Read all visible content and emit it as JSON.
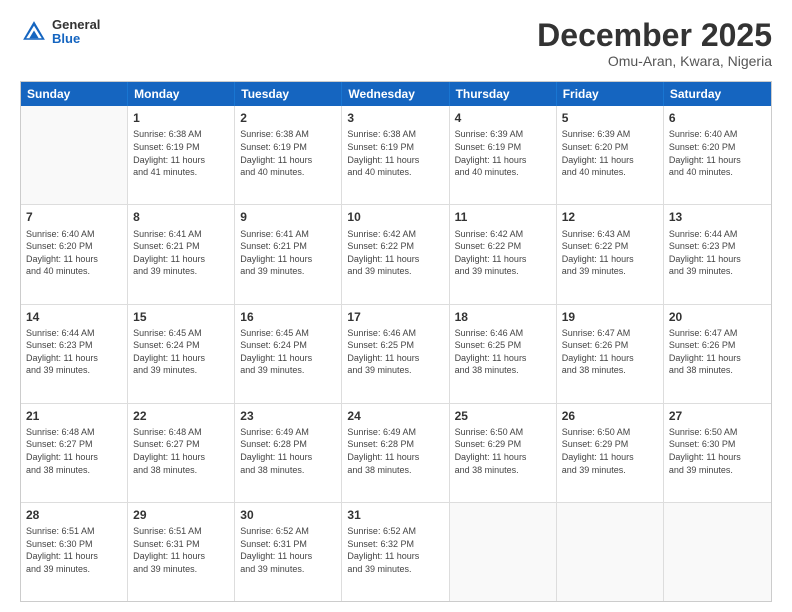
{
  "header": {
    "logo": {
      "general": "General",
      "blue": "Blue"
    },
    "title": "December 2025",
    "location": "Omu-Aran, Kwara, Nigeria"
  },
  "days": [
    "Sunday",
    "Monday",
    "Tuesday",
    "Wednesday",
    "Thursday",
    "Friday",
    "Saturday"
  ],
  "weeks": [
    [
      {
        "day": "",
        "sunrise": "",
        "sunset": "",
        "daylight": ""
      },
      {
        "day": "1",
        "sunrise": "Sunrise: 6:38 AM",
        "sunset": "Sunset: 6:19 PM",
        "daylight": "Daylight: 11 hours and 41 minutes."
      },
      {
        "day": "2",
        "sunrise": "Sunrise: 6:38 AM",
        "sunset": "Sunset: 6:19 PM",
        "daylight": "Daylight: 11 hours and 40 minutes."
      },
      {
        "day": "3",
        "sunrise": "Sunrise: 6:38 AM",
        "sunset": "Sunset: 6:19 PM",
        "daylight": "Daylight: 11 hours and 40 minutes."
      },
      {
        "day": "4",
        "sunrise": "Sunrise: 6:39 AM",
        "sunset": "Sunset: 6:19 PM",
        "daylight": "Daylight: 11 hours and 40 minutes."
      },
      {
        "day": "5",
        "sunrise": "Sunrise: 6:39 AM",
        "sunset": "Sunset: 6:20 PM",
        "daylight": "Daylight: 11 hours and 40 minutes."
      },
      {
        "day": "6",
        "sunrise": "Sunrise: 6:40 AM",
        "sunset": "Sunset: 6:20 PM",
        "daylight": "Daylight: 11 hours and 40 minutes."
      }
    ],
    [
      {
        "day": "7",
        "sunrise": "Sunrise: 6:40 AM",
        "sunset": "Sunset: 6:20 PM",
        "daylight": "Daylight: 11 hours and 40 minutes."
      },
      {
        "day": "8",
        "sunrise": "Sunrise: 6:41 AM",
        "sunset": "Sunset: 6:21 PM",
        "daylight": "Daylight: 11 hours and 39 minutes."
      },
      {
        "day": "9",
        "sunrise": "Sunrise: 6:41 AM",
        "sunset": "Sunset: 6:21 PM",
        "daylight": "Daylight: 11 hours and 39 minutes."
      },
      {
        "day": "10",
        "sunrise": "Sunrise: 6:42 AM",
        "sunset": "Sunset: 6:22 PM",
        "daylight": "Daylight: 11 hours and 39 minutes."
      },
      {
        "day": "11",
        "sunrise": "Sunrise: 6:42 AM",
        "sunset": "Sunset: 6:22 PM",
        "daylight": "Daylight: 11 hours and 39 minutes."
      },
      {
        "day": "12",
        "sunrise": "Sunrise: 6:43 AM",
        "sunset": "Sunset: 6:22 PM",
        "daylight": "Daylight: 11 hours and 39 minutes."
      },
      {
        "day": "13",
        "sunrise": "Sunrise: 6:44 AM",
        "sunset": "Sunset: 6:23 PM",
        "daylight": "Daylight: 11 hours and 39 minutes."
      }
    ],
    [
      {
        "day": "14",
        "sunrise": "Sunrise: 6:44 AM",
        "sunset": "Sunset: 6:23 PM",
        "daylight": "Daylight: 11 hours and 39 minutes."
      },
      {
        "day": "15",
        "sunrise": "Sunrise: 6:45 AM",
        "sunset": "Sunset: 6:24 PM",
        "daylight": "Daylight: 11 hours and 39 minutes."
      },
      {
        "day": "16",
        "sunrise": "Sunrise: 6:45 AM",
        "sunset": "Sunset: 6:24 PM",
        "daylight": "Daylight: 11 hours and 39 minutes."
      },
      {
        "day": "17",
        "sunrise": "Sunrise: 6:46 AM",
        "sunset": "Sunset: 6:25 PM",
        "daylight": "Daylight: 11 hours and 39 minutes."
      },
      {
        "day": "18",
        "sunrise": "Sunrise: 6:46 AM",
        "sunset": "Sunset: 6:25 PM",
        "daylight": "Daylight: 11 hours and 38 minutes."
      },
      {
        "day": "19",
        "sunrise": "Sunrise: 6:47 AM",
        "sunset": "Sunset: 6:26 PM",
        "daylight": "Daylight: 11 hours and 38 minutes."
      },
      {
        "day": "20",
        "sunrise": "Sunrise: 6:47 AM",
        "sunset": "Sunset: 6:26 PM",
        "daylight": "Daylight: 11 hours and 38 minutes."
      }
    ],
    [
      {
        "day": "21",
        "sunrise": "Sunrise: 6:48 AM",
        "sunset": "Sunset: 6:27 PM",
        "daylight": "Daylight: 11 hours and 38 minutes."
      },
      {
        "day": "22",
        "sunrise": "Sunrise: 6:48 AM",
        "sunset": "Sunset: 6:27 PM",
        "daylight": "Daylight: 11 hours and 38 minutes."
      },
      {
        "day": "23",
        "sunrise": "Sunrise: 6:49 AM",
        "sunset": "Sunset: 6:28 PM",
        "daylight": "Daylight: 11 hours and 38 minutes."
      },
      {
        "day": "24",
        "sunrise": "Sunrise: 6:49 AM",
        "sunset": "Sunset: 6:28 PM",
        "daylight": "Daylight: 11 hours and 38 minutes."
      },
      {
        "day": "25",
        "sunrise": "Sunrise: 6:50 AM",
        "sunset": "Sunset: 6:29 PM",
        "daylight": "Daylight: 11 hours and 38 minutes."
      },
      {
        "day": "26",
        "sunrise": "Sunrise: 6:50 AM",
        "sunset": "Sunset: 6:29 PM",
        "daylight": "Daylight: 11 hours and 39 minutes."
      },
      {
        "day": "27",
        "sunrise": "Sunrise: 6:50 AM",
        "sunset": "Sunset: 6:30 PM",
        "daylight": "Daylight: 11 hours and 39 minutes."
      }
    ],
    [
      {
        "day": "28",
        "sunrise": "Sunrise: 6:51 AM",
        "sunset": "Sunset: 6:30 PM",
        "daylight": "Daylight: 11 hours and 39 minutes."
      },
      {
        "day": "29",
        "sunrise": "Sunrise: 6:51 AM",
        "sunset": "Sunset: 6:31 PM",
        "daylight": "Daylight: 11 hours and 39 minutes."
      },
      {
        "day": "30",
        "sunrise": "Sunrise: 6:52 AM",
        "sunset": "Sunset: 6:31 PM",
        "daylight": "Daylight: 11 hours and 39 minutes."
      },
      {
        "day": "31",
        "sunrise": "Sunrise: 6:52 AM",
        "sunset": "Sunset: 6:32 PM",
        "daylight": "Daylight: 11 hours and 39 minutes."
      },
      {
        "day": "",
        "sunrise": "",
        "sunset": "",
        "daylight": ""
      },
      {
        "day": "",
        "sunrise": "",
        "sunset": "",
        "daylight": ""
      },
      {
        "day": "",
        "sunrise": "",
        "sunset": "",
        "daylight": ""
      }
    ]
  ]
}
